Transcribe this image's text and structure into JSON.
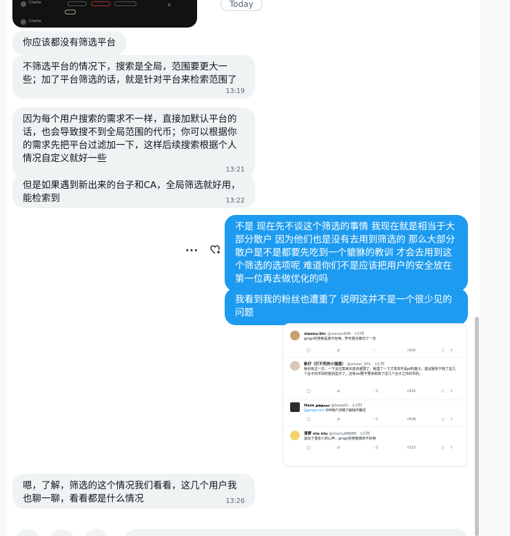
{
  "date_separator": "Today",
  "messages": [
    {
      "text": "你应该都没有筛选平台",
      "time": ""
    },
    {
      "text": "不筛选平台的情况下，搜索是全局，范围要更大一些；加了平台筛选的话，就是针对平台来检索范围了",
      "time": "13:19"
    },
    {
      "text": "因为每个用户搜索的需求不一样，直接加默认平台的话，也会导致搜不到全局范围的代币；你可以根据你的需求先把平台过滤加一下，这样后续搜索根据个人情况自定义就好一些",
      "time": "13:21"
    },
    {
      "text": "但是如果遇到新出来的台子和CA，全局筛选就好用，能检索到",
      "time": "13:22"
    },
    {
      "text": "不是 现在先不谈这个筛选的事情 我现在就是相当于大部分散户 因为他们也是没有去用到筛选的 那么大部分散户是不是都要先吃到一个貔貅的教训 才会去用到这个筛选的选项呢 难道你们不是应该把用户的安全放在第一位再去做优化的吗",
      "time": ""
    },
    {
      "text": "我看到我的粉丝也遭重了 说明这并不是一个很少见的问题",
      "time": ""
    },
    {
      "text": "嗯，了解，筛选的这个情况我们看看，这几个用户我也聊一聊，看看都是什么情况",
      "time": "13:26"
    }
  ],
  "top_screenshot": {
    "name1": "Charlie",
    "name2": "Charlie",
    "value": "0"
  },
  "image_tweets": [
    {
      "name": "xiaosu.btc",
      "handle": "@xiaosu998 · 1小时",
      "text": "gmgn的搜索是真不好用，昨天我也被坑了一次",
      "mention": "",
      "views": "142",
      "replies": "",
      "reposts": "",
      "likes": ""
    },
    {
      "name": "新仔（打不死的小强版）",
      "handle": "@xinzai_001 · 1小时",
      "text": "我也有过一次，一下没注意来买进去被埋了，我埋了一下才发现不是pf的盘子。建议服务于除了这几个台子的币别的能别显示了。还有sol要不要会帐除了这几个台子之外的币的。",
      "mention": "",
      "views": "151",
      "replies": "",
      "reposts": "",
      "likes": "1"
    },
    {
      "name": "Haze 𝓰𝓶𝓰𝓷𝓪𝓲",
      "handle": "@haze0x · 1小时",
      "text": "DM用户详细了解操作路径",
      "mention": "@gmgncom",
      "views": "536",
      "replies": "",
      "reposts": "",
      "likes": "1"
    },
    {
      "name": "潭萝 niu niu",
      "handle": "@niuniu88888 · 1小时",
      "text": "说出了很多人的心声，gmgn的搜索真的不好用",
      "mention": "",
      "views": "122",
      "replies": "",
      "reposts": "",
      "likes": "1"
    }
  ],
  "colors": {
    "outgoing": "#1d9bf0",
    "incoming": "#eff3f4"
  }
}
